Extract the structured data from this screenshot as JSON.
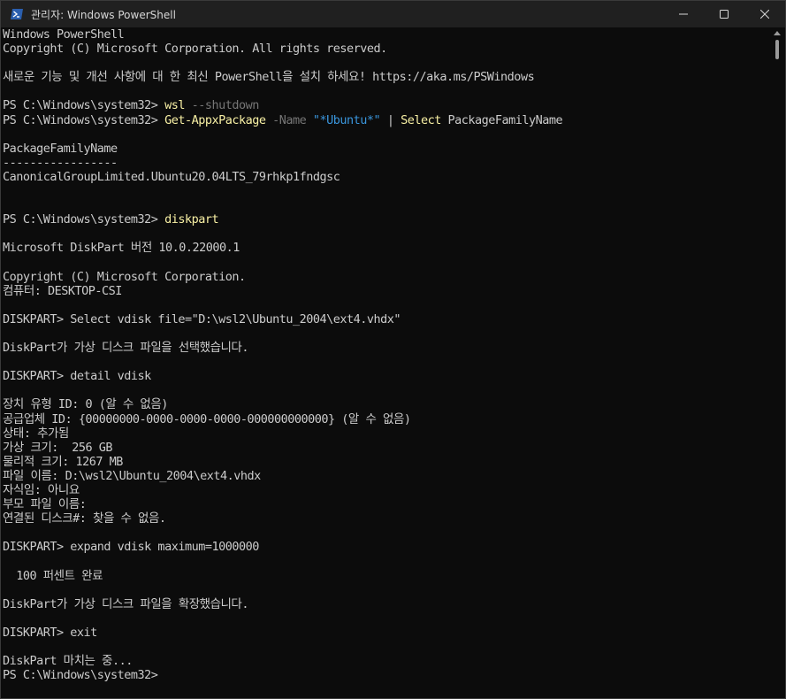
{
  "window": {
    "title": "관리자: Windows PowerShell",
    "icon": "powershell-icon",
    "controls": [
      "minimize-icon",
      "maximize-icon",
      "close-icon"
    ]
  },
  "colors": {
    "background": "#0c0c0c",
    "titlebar": "#202020",
    "text": "#cccccc",
    "command": "#f9f1a5",
    "parameter": "#767676",
    "string": "#3a96dd"
  },
  "console": {
    "lines": [
      [
        {
          "t": "Windows PowerShell",
          "c": "text"
        }
      ],
      [
        {
          "t": "Copyright (C) Microsoft Corporation. All rights reserved.",
          "c": "text"
        }
      ],
      [],
      [
        {
          "t": "새로운 기능 및 개선 사항에 대 한 최신 PowerShell을 설치 하세요! https://aka.ms/PSWindows",
          "c": "text"
        }
      ],
      [],
      [
        {
          "t": "PS C:\\Windows\\system32> ",
          "c": "prompt"
        },
        {
          "t": "wsl",
          "c": "cmd"
        },
        {
          "t": " --shutdown",
          "c": "param"
        }
      ],
      [
        {
          "t": "PS C:\\Windows\\system32> ",
          "c": "prompt"
        },
        {
          "t": "Get-AppxPackage",
          "c": "cmd"
        },
        {
          "t": " -Name",
          "c": "param"
        },
        {
          "t": " \"*Ubuntu*\"",
          "c": "str"
        },
        {
          "t": " | ",
          "c": "text"
        },
        {
          "t": "Select",
          "c": "cmd"
        },
        {
          "t": " PackageFamilyName",
          "c": "text"
        }
      ],
      [],
      [
        {
          "t": "PackageFamilyName",
          "c": "text"
        }
      ],
      [
        {
          "t": "-----------------",
          "c": "text"
        }
      ],
      [
        {
          "t": "CanonicalGroupLimited.Ubuntu20.04LTS_79rhkp1fndgsc",
          "c": "text"
        }
      ],
      [],
      [],
      [
        {
          "t": "PS C:\\Windows\\system32> ",
          "c": "prompt"
        },
        {
          "t": "diskpart",
          "c": "cmd"
        }
      ],
      [],
      [
        {
          "t": "Microsoft DiskPart 버전 10.0.22000.1",
          "c": "text"
        }
      ],
      [],
      [
        {
          "t": "Copyright (C) Microsoft Corporation.",
          "c": "text"
        }
      ],
      [
        {
          "t": "컴퓨터: DESKTOP-CSI",
          "c": "text"
        }
      ],
      [],
      [
        {
          "t": "DISKPART> Select vdisk file=\"D:\\wsl2\\Ubuntu_2004\\ext4.vhdx\"",
          "c": "text"
        }
      ],
      [],
      [
        {
          "t": "DiskPart가 가상 디스크 파일을 선택했습니다.",
          "c": "text"
        }
      ],
      [],
      [
        {
          "t": "DISKPART> detail vdisk",
          "c": "text"
        }
      ],
      [],
      [
        {
          "t": "장치 유형 ID: 0 (알 수 없음)",
          "c": "text"
        }
      ],
      [
        {
          "t": "공급업체 ID: {00000000-0000-0000-0000-000000000000} (알 수 없음)",
          "c": "text"
        }
      ],
      [
        {
          "t": "상태: 추가됨",
          "c": "text"
        }
      ],
      [
        {
          "t": "가상 크기:  256 GB",
          "c": "text"
        }
      ],
      [
        {
          "t": "물리적 크기: 1267 MB",
          "c": "text"
        }
      ],
      [
        {
          "t": "파일 이름: D:\\wsl2\\Ubuntu_2004\\ext4.vhdx",
          "c": "text"
        }
      ],
      [
        {
          "t": "자식임: 아니요",
          "c": "text"
        }
      ],
      [
        {
          "t": "부모 파일 이름:",
          "c": "text"
        }
      ],
      [
        {
          "t": "연결된 디스크#: 찾을 수 없음.",
          "c": "text"
        }
      ],
      [],
      [
        {
          "t": "DISKPART> expand vdisk maximum=1000000",
          "c": "text"
        }
      ],
      [],
      [
        {
          "t": "  100 퍼센트 완료",
          "c": "text"
        }
      ],
      [],
      [
        {
          "t": "DiskPart가 가상 디스크 파일을 확장했습니다.",
          "c": "text"
        }
      ],
      [],
      [
        {
          "t": "DISKPART> exit",
          "c": "text"
        }
      ],
      [],
      [
        {
          "t": "DiskPart 마치는 중...",
          "c": "text"
        }
      ],
      [
        {
          "t": "PS C:\\Windows\\system32>",
          "c": "prompt"
        }
      ]
    ]
  }
}
